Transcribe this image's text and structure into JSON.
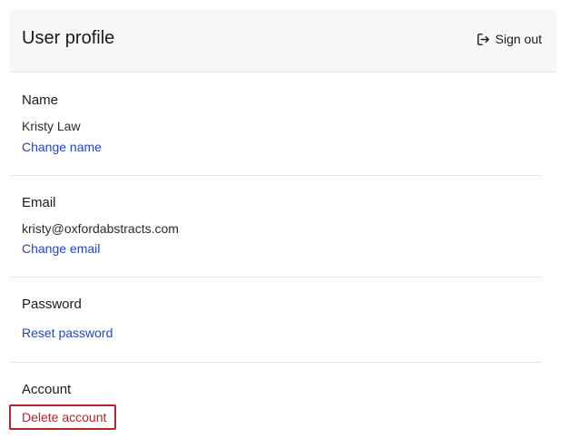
{
  "header": {
    "title": "User profile",
    "signout_label": "Sign out",
    "signout_icon": "sign-out-icon"
  },
  "sections": {
    "name": {
      "title": "Name",
      "value": "Kristy Law",
      "action": "Change name"
    },
    "email": {
      "title": "Email",
      "value": "kristy@oxfordabstracts.com",
      "action": "Change email"
    },
    "password": {
      "title": "Password",
      "action": "Reset password"
    },
    "account": {
      "title": "Account",
      "action": "Delete account"
    }
  },
  "colors": {
    "link": "#2347b8",
    "danger": "#b3262f",
    "header_bg": "#f6f7f8"
  }
}
